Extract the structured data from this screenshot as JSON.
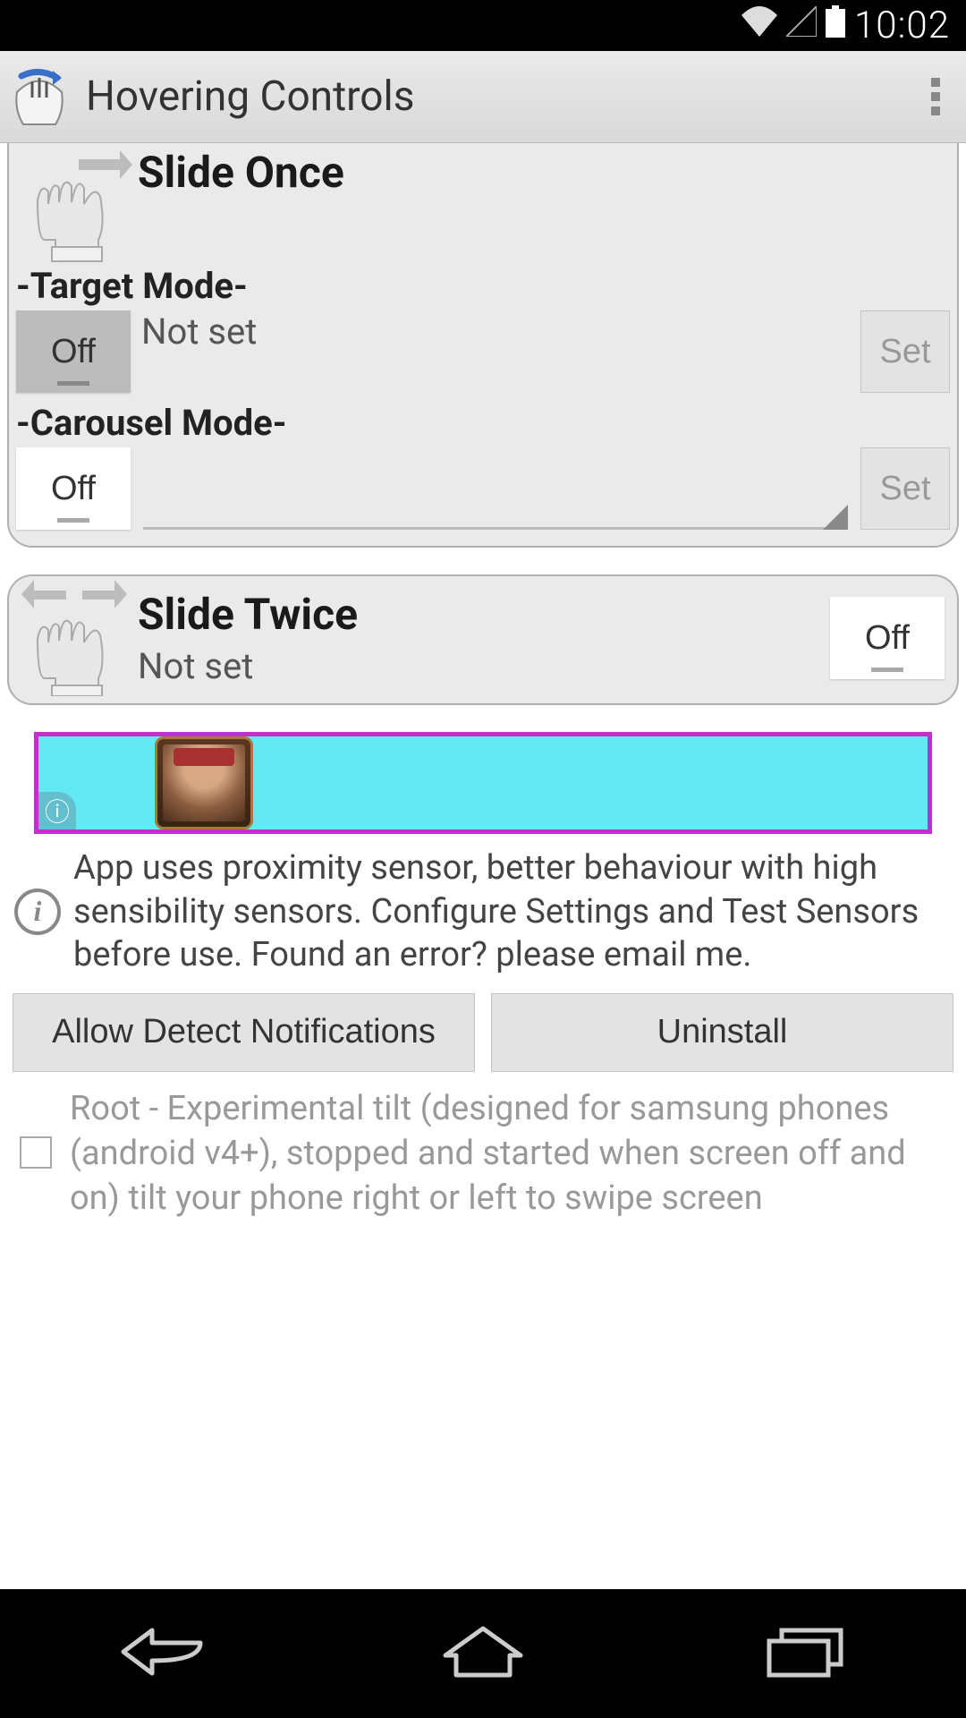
{
  "status": {
    "time": "10:02"
  },
  "header": {
    "title": "Hovering Controls"
  },
  "card1": {
    "title": "Slide Once",
    "mode1": {
      "label": "-Target Mode-",
      "toggle": "Off",
      "value": "Not set",
      "set": "Set"
    },
    "mode2": {
      "label": "-Carousel Mode-",
      "toggle": "Off",
      "set": "Set"
    }
  },
  "card2": {
    "title": "Slide Twice",
    "value": "Not set",
    "toggle": "Off"
  },
  "info": {
    "text": "App uses proximity sensor, better behaviour with high sensibility sensors. Configure Settings and Test Sensors before use. Found an error? please email me."
  },
  "buttons": {
    "left": "Allow Detect Notifications",
    "right": "Uninstall"
  },
  "check": {
    "text": "Root - Experimental tilt (designed for samsung phones (android v4+), stopped and started when screen off and on) tilt your phone right or left to swipe screen"
  }
}
